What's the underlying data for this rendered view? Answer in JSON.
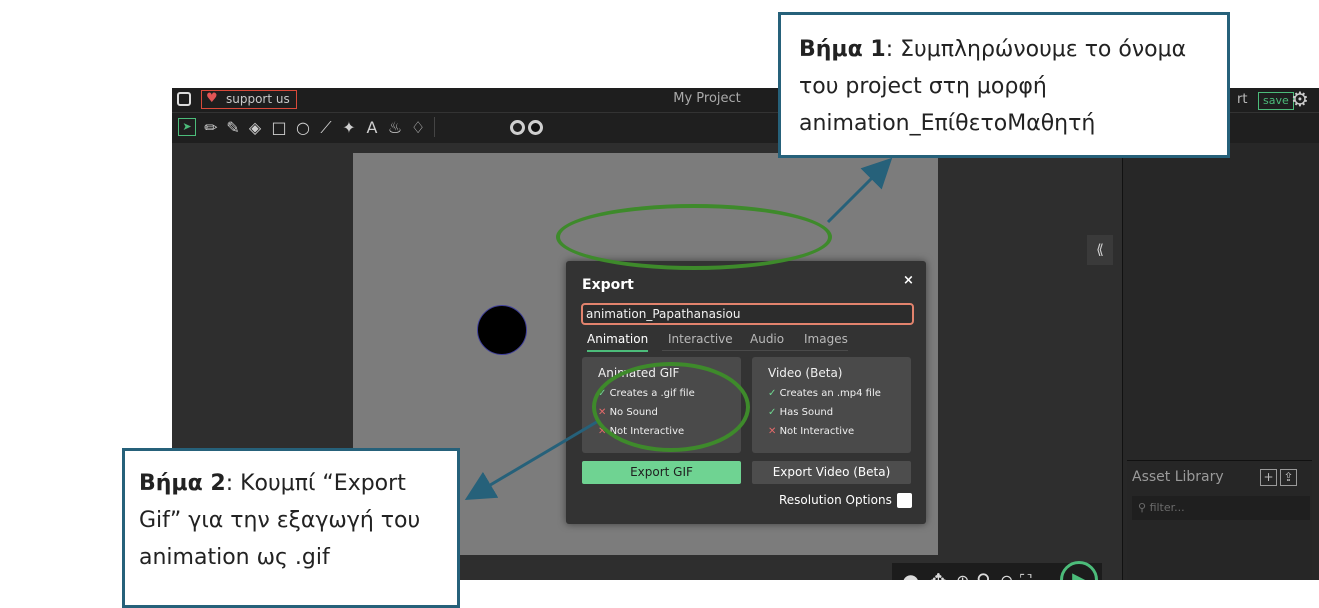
{
  "app": {
    "support_label": "support us",
    "project_title": "My Project",
    "export_label_partial": "rt",
    "save_label": "save"
  },
  "panel": {
    "collapse_glyph": "⟪",
    "asset_library_title": "Asset Library",
    "filter_placeholder": "filter..."
  },
  "dialog": {
    "title": "Export",
    "close_glyph": "×",
    "filename_value": "animation_Papathanasiou",
    "tabs": [
      {
        "label": "Animation",
        "active": true
      },
      {
        "label": "Interactive",
        "active": false
      },
      {
        "label": "Audio",
        "active": false
      },
      {
        "label": "Images",
        "active": false
      }
    ],
    "gif_card": {
      "title": "Animated GIF",
      "features": [
        "Creates a .gif file",
        "No Sound",
        "Not Interactive"
      ]
    },
    "video_card": {
      "title": "Video (Beta)",
      "features": [
        "Creates an .mp4 file",
        "Has Sound",
        "Not Interactive"
      ]
    },
    "export_gif_label": "Export GIF",
    "export_video_label": "Export Video (Beta)",
    "resolution_label": "Resolution Options"
  },
  "callouts": {
    "step1_bold": "Βήμα 1",
    "step1_text": ": Συμπληρώνουμε το όνομα του project στη μορφή animation_ΕπίθετοΜαθητή",
    "step2_bold": "Βήμα 2",
    "step2_text": ": Κουμπί “Export Gif” για την εξαγωγή του animation ως .gif"
  },
  "colors": {
    "accent_green": "#4cbc7a",
    "annotation_green": "#3e8a2b",
    "annotation_blue": "#26617a",
    "input_border": "#e2836d"
  }
}
